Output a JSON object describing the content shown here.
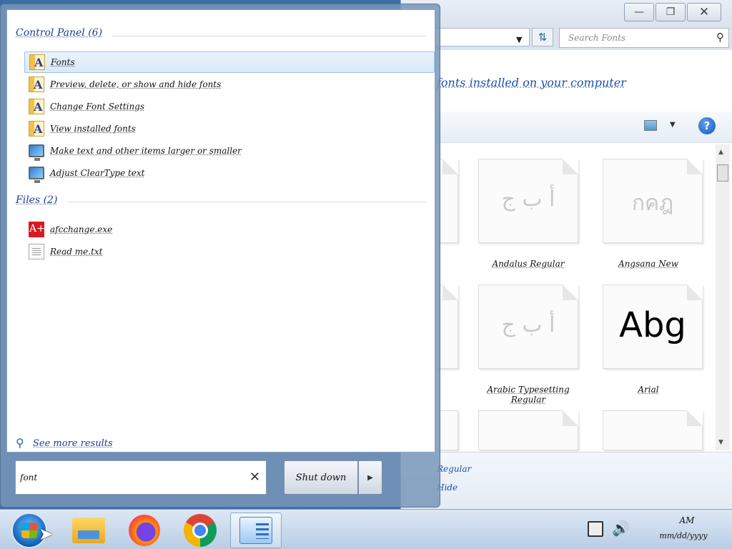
{
  "fonts_window": {
    "search_placeholder": "Search Fonts",
    "header_text": "fonts installed on your computer",
    "tiles": [
      {
        "sample": "أ ب ج",
        "name": "Andalus Regular"
      },
      {
        "sample": "กคฎ",
        "name": "Angsana New"
      },
      {
        "sample": "أ ب ج",
        "name": "Arabic Typesetting Regular"
      },
      {
        "sample": "Abg",
        "name": "Arial"
      }
    ],
    "details": [
      "Regular",
      "Hide"
    ]
  },
  "start_menu": {
    "groups": [
      {
        "header": "Control Panel (6)",
        "items": [
          {
            "label": "Fonts",
            "icon": "font-folder-icon"
          },
          {
            "label": "Preview, delete, or show and hide fonts",
            "icon": "font-folder-icon"
          },
          {
            "label": "Change Font Settings",
            "icon": "font-folder-icon"
          },
          {
            "label": "View installed fonts",
            "icon": "font-folder-icon"
          },
          {
            "label": "Make text and other items larger or smaller",
            "icon": "display-icon"
          },
          {
            "label": "Adjust ClearType text",
            "icon": "display-icon"
          }
        ]
      },
      {
        "header": "Files (2)",
        "items": [
          {
            "label": "afcchange.exe",
            "icon": "app-icon"
          },
          {
            "label": "Read me.txt",
            "icon": "text-file-icon"
          }
        ]
      }
    ],
    "see_more_label": "See more results",
    "search_value": "font",
    "shutdown_label": "Shut down"
  },
  "taskbar": {
    "clock_time": "AM",
    "clock_date": "mm/dd/yyyy"
  },
  "colors": {
    "accent_blue": "#1e4fa8",
    "selection": "#d9e9f8",
    "taskbar": "#b9cde4"
  }
}
